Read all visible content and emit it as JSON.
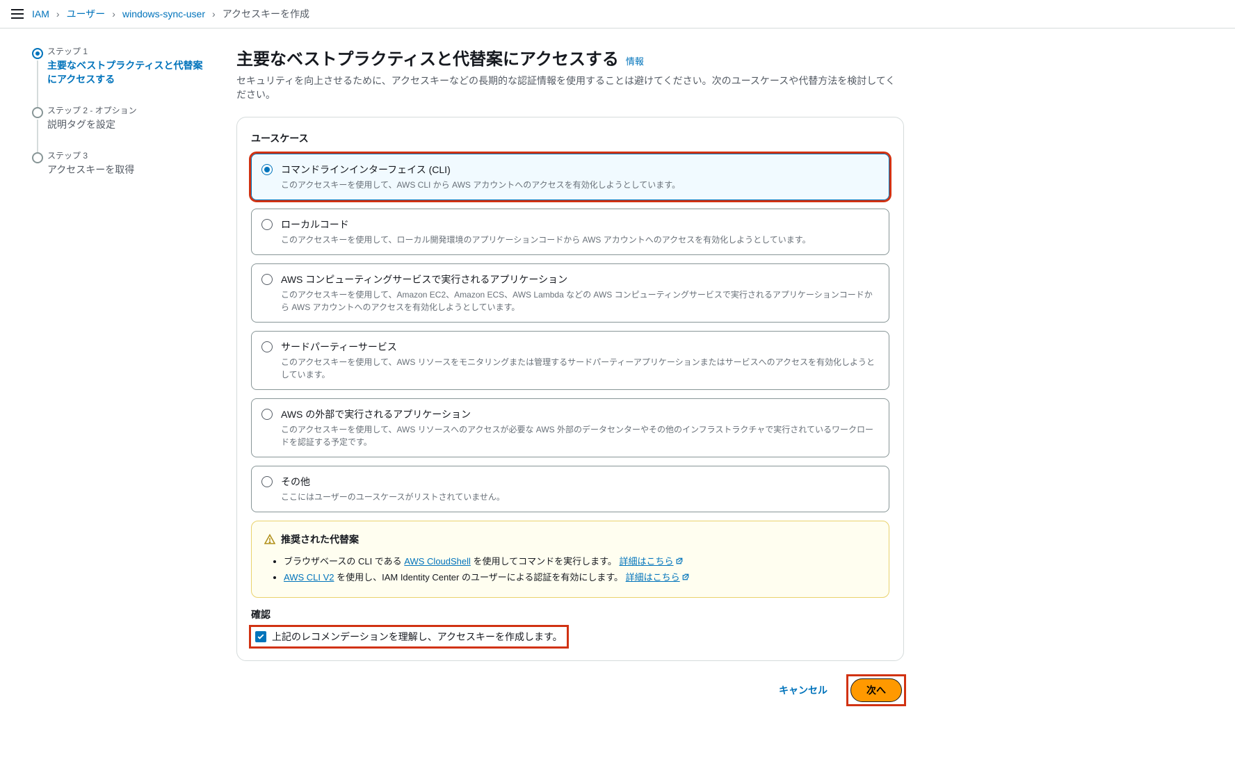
{
  "breadcrumb": {
    "items": [
      {
        "label": "IAM",
        "link": true
      },
      {
        "label": "ユーザー",
        "link": true
      },
      {
        "label": "windows-sync-user",
        "link": true
      },
      {
        "label": "アクセスキーを作成",
        "link": false
      }
    ]
  },
  "stepper": [
    {
      "step": "ステップ 1",
      "title": "主要なベストプラクティスと代替案にアクセスする",
      "active": true
    },
    {
      "step": "ステップ 2 - オプション",
      "title": "説明タグを設定",
      "active": false
    },
    {
      "step": "ステップ 3",
      "title": "アクセスキーを取得",
      "active": false
    }
  ],
  "page": {
    "title": "主要なベストプラクティスと代替案にアクセスする",
    "info": "情報",
    "subtitle": "セキュリティを向上させるために、アクセスキーなどの長期的な認証情報を使用することは避けてください。次のユースケースや代替方法を検討してください。"
  },
  "usecase_label": "ユースケース",
  "options": [
    {
      "title": "コマンドラインインターフェイス (CLI)",
      "desc": "このアクセスキーを使用して、AWS CLI から AWS アカウントへのアクセスを有効化しようとしています。",
      "selected": true
    },
    {
      "title": "ローカルコード",
      "desc": "このアクセスキーを使用して、ローカル開発環境のアプリケーションコードから AWS アカウントへのアクセスを有効化しようとしています。",
      "selected": false
    },
    {
      "title": "AWS コンピューティングサービスで実行されるアプリケーション",
      "desc": "このアクセスキーを使用して、Amazon EC2、Amazon ECS、AWS Lambda などの AWS コンピューティングサービスで実行されるアプリケーションコードから AWS アカウントへのアクセスを有効化しようとしています。",
      "selected": false
    },
    {
      "title": "サードパーティーサービス",
      "desc": "このアクセスキーを使用して、AWS リソースをモニタリングまたは管理するサードパーティーアプリケーションまたはサービスへのアクセスを有効化しようとしています。",
      "selected": false
    },
    {
      "title": "AWS の外部で実行されるアプリケーション",
      "desc": "このアクセスキーを使用して、AWS リソースへのアクセスが必要な AWS 外部のデータセンターやその他のインフラストラクチャで実行されているワークロードを認証する予定です。",
      "selected": false
    },
    {
      "title": "その他",
      "desc": "ここにはユーザーのユースケースがリストされていません。",
      "selected": false
    }
  ],
  "alternatives": {
    "heading": "推奨された代替案",
    "items": [
      {
        "prefix": "ブラウザベースの CLI である ",
        "link1": "AWS CloudShell",
        "middle": " を使用してコマンドを実行します。",
        "link2": "詳細はこちら"
      },
      {
        "prefix": "",
        "link1": "AWS CLI V2",
        "middle": " を使用し、IAM Identity Center のユーザーによる認証を有効にします。",
        "link2": "詳細はこちら"
      }
    ]
  },
  "confirm": {
    "label": "確認",
    "text": "上記のレコメンデーションを理解し、アクセスキーを作成します。",
    "checked": true
  },
  "buttons": {
    "cancel": "キャンセル",
    "next": "次へ"
  }
}
